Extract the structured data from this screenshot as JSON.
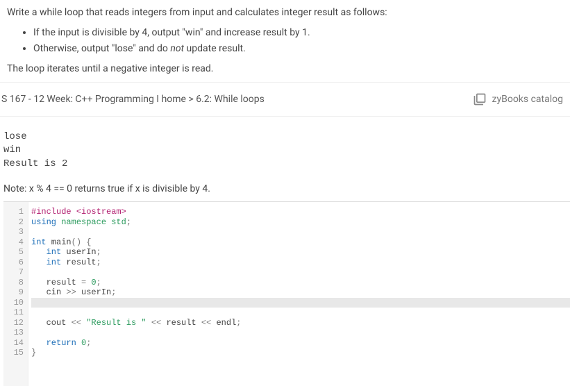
{
  "instructions": {
    "intro": "Write a while loop that reads integers from input and calculates integer result as follows:",
    "bullet1_a": "If the input is divisible by 4, output \"win\" and increase result by 1.",
    "bullet2_a": "Otherwise, output \"lose\" and do ",
    "bullet2_b": "not",
    "bullet2_c": " update result.",
    "outro": "The loop iterates until a negative integer is read."
  },
  "nav": {
    "breadcrumb_left": "S 167 - 12 Week: C++ Programming I home > 6.2: While loops",
    "catalog_label": "zyBooks catalog"
  },
  "console": {
    "line1": "lose",
    "line2": "win",
    "line3": "Result is 2"
  },
  "note": "Note: x % 4 == 0 returns true if x is divisible by 4.",
  "code": {
    "lines": [
      "1",
      "2",
      "3",
      "4",
      "5",
      "6",
      "7",
      "8",
      "9",
      "10",
      "11",
      "12",
      "13",
      "14",
      "15"
    ],
    "l1_a": "#include ",
    "l1_b": "<iostream>",
    "l2_a": "using",
    "l2_b": " namespace",
    "l2_c": " std",
    "l2_d": ";",
    "l4_a": "int",
    "l4_b": " main",
    "l4_c": "()",
    "l4_d": " {",
    "l5_a": "   int",
    "l5_b": " userIn",
    "l5_c": ";",
    "l6_a": "   int",
    "l6_b": " result",
    "l6_c": ";",
    "l8_a": "   result ",
    "l8_b": "=",
    "l8_c": " 0",
    "l8_d": ";",
    "l9_a": "   cin ",
    "l9_b": ">>",
    "l9_c": " userIn",
    "l9_d": ";",
    "l12_a": "   cout ",
    "l12_b": "<<",
    "l12_c": " \"Result is \"",
    "l12_d": " <<",
    "l12_e": " result ",
    "l12_f": "<<",
    "l12_g": " endl",
    "l12_h": ";",
    "l14_a": "   return",
    "l14_b": " 0",
    "l14_c": ";",
    "l15_a": "}"
  }
}
